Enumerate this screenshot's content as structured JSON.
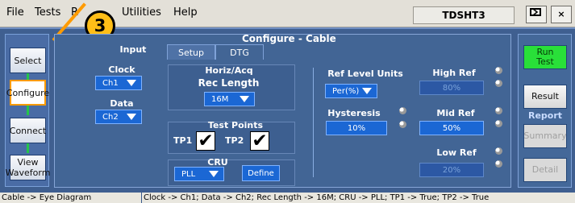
{
  "menu": {
    "items": [
      "File",
      "Tests",
      "R",
      "Utilities",
      "Help"
    ],
    "app_title": "TDSHT3",
    "window_buttons": [
      "minimize-restore",
      "×"
    ]
  },
  "callout": "3",
  "nav": {
    "items": [
      "Select",
      "Configure",
      "Connect",
      "View\nWaveform"
    ],
    "active": "Configure"
  },
  "panel": {
    "title": "Configure - Cable",
    "tabs": [
      "Setup",
      "DTG"
    ],
    "input": {
      "header": "Input",
      "clock_label": "Clock",
      "clock_value": "Ch1",
      "data_label": "Data",
      "data_value": "Ch2"
    },
    "horiz": {
      "header": "Horiz/Acq",
      "rec_length_label": "Rec Length",
      "rec_length_value": "16M"
    },
    "test_points": {
      "header": "Test Points",
      "tp1_label": "TP1",
      "tp2_label": "TP2",
      "tp1_checked": "✔",
      "tp2_checked": "✔"
    },
    "cru": {
      "header": "CRU",
      "value": "PLL",
      "define_label": "Define"
    },
    "ref": {
      "units_label": "Ref Level Units",
      "units_value": "Per(%)",
      "hysteresis_label": "Hysteresis",
      "hysteresis_value": "10%",
      "high_ref_label": "High Ref",
      "high_ref_value": "80%",
      "mid_ref_label": "Mid Ref",
      "mid_ref_value": "50%",
      "low_ref_label": "Low Ref",
      "low_ref_value": "20%"
    }
  },
  "right": {
    "run_test": "Run\nTest",
    "result": "Result",
    "report_header": "Report",
    "summary": "Summary",
    "detail": "Detail"
  },
  "status": {
    "left": "Cable -> Eye Diagram",
    "right": "Clock -> Ch1; Data -> Ch2; Rec Length -> 16M; CRU -> PLL; TP1 -> True; TP2 -> True"
  }
}
